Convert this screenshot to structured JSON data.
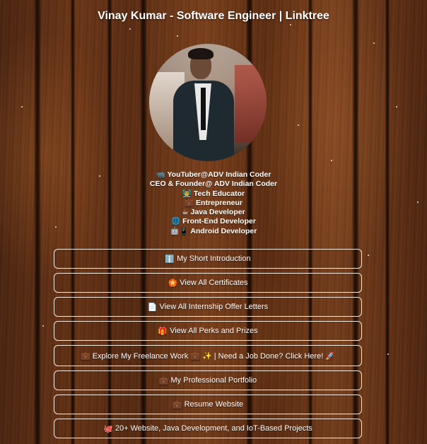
{
  "page": {
    "title": "Vinay Kumar - Software Engineer | Linktree"
  },
  "profile": {
    "avatar_alt": "Vinay Kumar profile photo"
  },
  "bio": [
    {
      "icon": "📹",
      "text": "YouTuber@ADV Indian Coder"
    },
    {
      "icon": "",
      "text": "CEO & Founder@ ADV Indian Coder"
    },
    {
      "icon": "👨‍🏫",
      "text": "Tech Educator"
    },
    {
      "icon": "💼",
      "text": "Entrepreneur"
    },
    {
      "icon": "☕",
      "text": "Java Developer"
    },
    {
      "icon": "🌐",
      "text": "Front-End Developer"
    },
    {
      "icon": "🤖📱",
      "text": "Android Developer"
    }
  ],
  "links": [
    {
      "icon": "ℹ️",
      "label": "My Short Introduction"
    },
    {
      "icon": "🏵️",
      "label": "View All Certificates"
    },
    {
      "icon": "📄",
      "label": "View All Internship Offer Letters"
    },
    {
      "icon": "🎁",
      "label": "View All Perks and Prizes"
    },
    {
      "icon": "💼",
      "label": "Explore My Freelance Work 💼 ✨ | Need a Job Done? Click Here! 🚀"
    },
    {
      "icon": "💼",
      "label": "My Professional Portfolio"
    },
    {
      "icon": "💼",
      "label": "Resume Website"
    },
    {
      "icon": "🐙",
      "label": "20+ Website, Java Development, and IoT-Based Projects"
    }
  ]
}
